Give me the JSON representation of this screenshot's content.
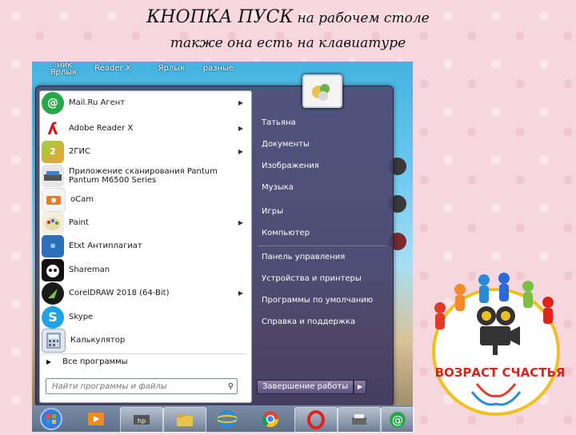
{
  "slide": {
    "title_big": "КНОПКА ПУСК",
    "title_rest": "на рабочем столе",
    "title_line2": "также она есть на клавиатуре"
  },
  "desktop_labels": [
    "...ник\n- Ярлык",
    "Reader X",
    "- Ярлык",
    "разные",
    "",
    ""
  ],
  "start_menu": {
    "programs": [
      {
        "label": "Mail.Ru Агент",
        "icon": "mailru-agent-icon",
        "arrow": true
      },
      {
        "label": "Adobe Reader X",
        "icon": "adobe-reader-icon",
        "arrow": true
      },
      {
        "label": "2ГИС",
        "icon": "2gis-icon",
        "arrow": true
      },
      {
        "label": "Приложение сканирования Pantum",
        "label2": "Pantum M6500 Series",
        "icon": "pantum-scanner-icon",
        "arrow": false
      },
      {
        "label": "oCam",
        "icon": "ocam-icon",
        "arrow": false
      },
      {
        "label": "Paint",
        "icon": "paint-icon",
        "arrow": true
      },
      {
        "label": "Etxt Антиплагиат",
        "icon": "etxt-icon",
        "arrow": false
      },
      {
        "label": "Shareman",
        "icon": "shareman-icon",
        "arrow": false
      },
      {
        "label": "CorelDRAW 2018 (64-Bit)",
        "icon": "coreldraw-icon",
        "arrow": true
      },
      {
        "label": "Skype",
        "icon": "skype-icon",
        "arrow": false
      },
      {
        "label": "Калькулятор",
        "icon": "calculator-icon",
        "arrow": false
      }
    ],
    "all_programs": "Все программы",
    "search_placeholder": "Найти программы и файлы",
    "right_items": [
      "Татьяна",
      "Документы",
      "Изображения",
      "Музыка",
      "Игры",
      "Компьютер",
      "Панель управления",
      "Устройства и принтеры",
      "Программы по умолчанию",
      "Справка и поддержка"
    ],
    "shutdown_label": "Завершение работы"
  },
  "taskbar": [
    "start-orb-icon",
    "media-player-icon",
    "hp-icon",
    "explorer-icon",
    "ie-icon",
    "chrome-icon",
    "opera-icon",
    "printer-icon",
    "mailru-icon"
  ],
  "logo": {
    "text": "ВОЗРАСТ СЧАСТЬЯ"
  },
  "colors": {
    "accent_red": "#e0221b",
    "logo_text": "#d8241c"
  }
}
